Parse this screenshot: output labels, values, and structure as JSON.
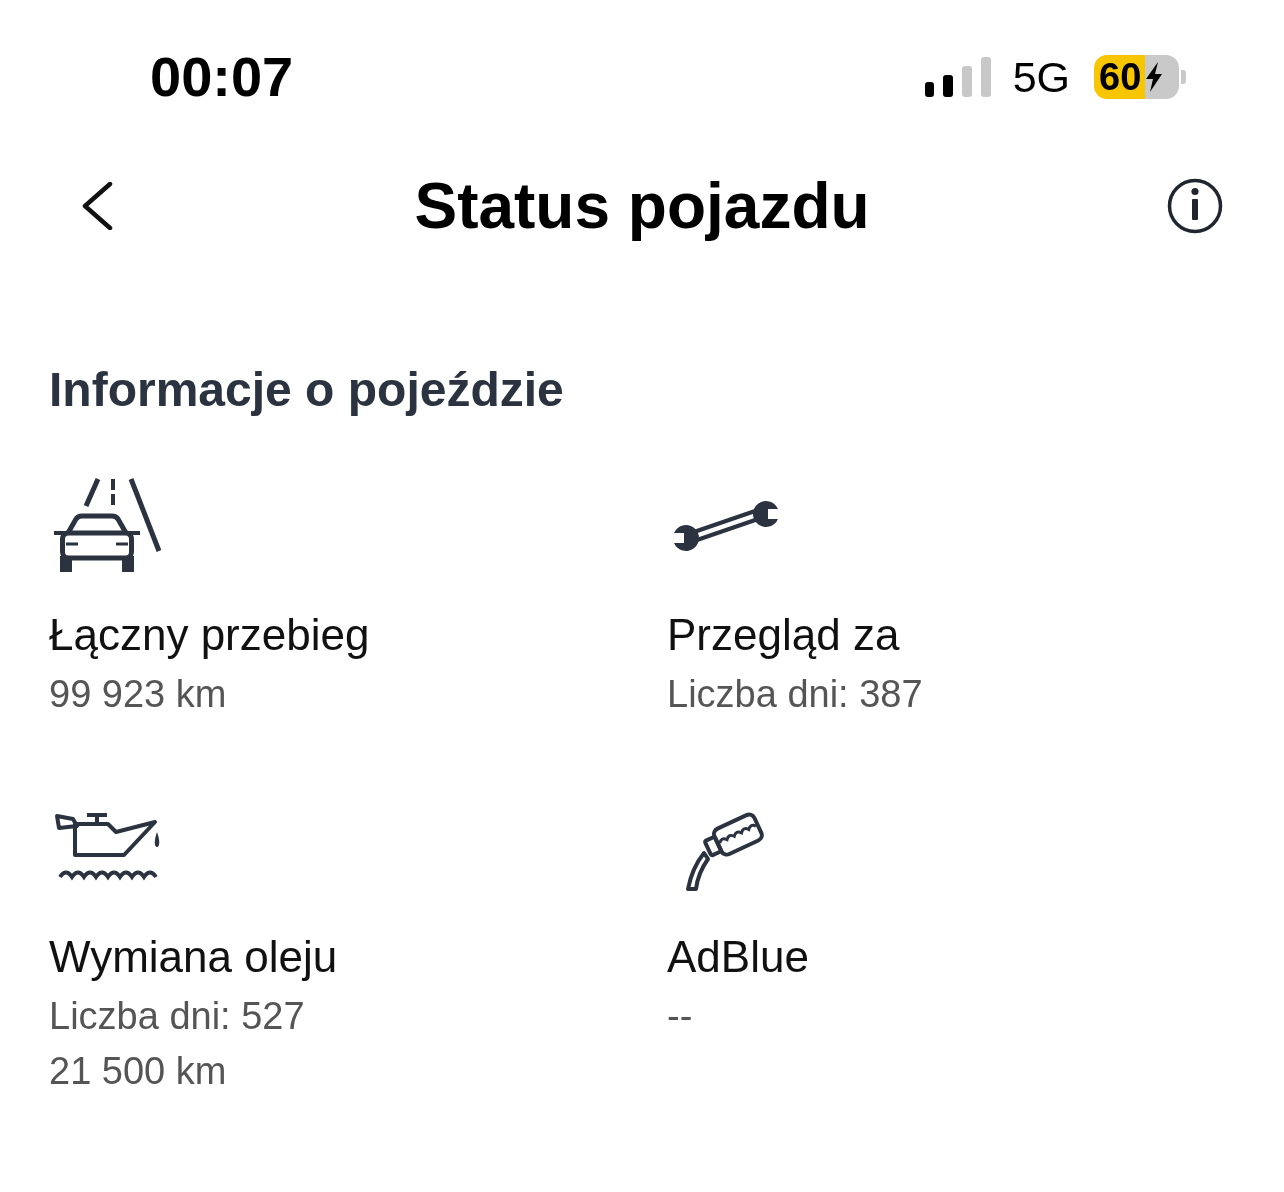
{
  "status_bar": {
    "time": "00:07",
    "network": "5G",
    "battery": "60"
  },
  "header": {
    "title": "Status pojazdu"
  },
  "section": {
    "title": "Informacje o pojeździe",
    "items": [
      {
        "kind": "mileage",
        "label": "Łączny przebieg",
        "values": [
          "99 923 km"
        ]
      },
      {
        "kind": "service",
        "label": "Przegląd za",
        "values": [
          "Liczba dni: 387"
        ]
      },
      {
        "kind": "oil",
        "label": "Wymiana oleju",
        "values": [
          "Liczba dni: 527",
          "21 500 km"
        ]
      },
      {
        "kind": "adblue",
        "label": "AdBlue",
        "values": [
          "--"
        ]
      }
    ]
  }
}
